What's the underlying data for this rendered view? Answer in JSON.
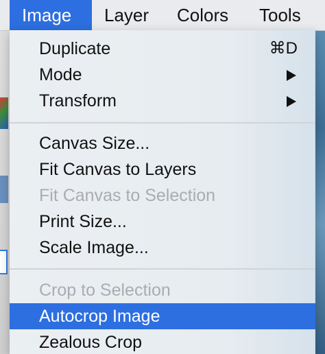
{
  "menubar": {
    "items": [
      {
        "label": "Image",
        "active": true
      },
      {
        "label": "Layer",
        "active": false
      },
      {
        "label": "Colors",
        "active": false
      },
      {
        "label": "Tools",
        "active": false
      }
    ]
  },
  "image_menu": {
    "groups": [
      {
        "items": [
          {
            "label": "Duplicate",
            "shortcut": "⌘D",
            "enabled": true
          },
          {
            "label": "Mode",
            "submenu": true,
            "enabled": true
          },
          {
            "label": "Transform",
            "submenu": true,
            "enabled": true
          }
        ]
      },
      {
        "items": [
          {
            "label": "Canvas Size...",
            "enabled": true
          },
          {
            "label": "Fit Canvas to Layers",
            "enabled": true
          },
          {
            "label": "Fit Canvas to Selection",
            "enabled": false
          },
          {
            "label": "Print Size...",
            "enabled": true
          },
          {
            "label": "Scale Image...",
            "enabled": true
          }
        ]
      },
      {
        "items": [
          {
            "label": "Crop to Selection",
            "enabled": false
          },
          {
            "label": "Autocrop Image",
            "enabled": true,
            "highlighted": true
          },
          {
            "label": "Zealous Crop",
            "enabled": true
          }
        ]
      }
    ]
  },
  "colors": {
    "highlight": "#2d6fe0",
    "disabled_text": "#a9adb2"
  }
}
